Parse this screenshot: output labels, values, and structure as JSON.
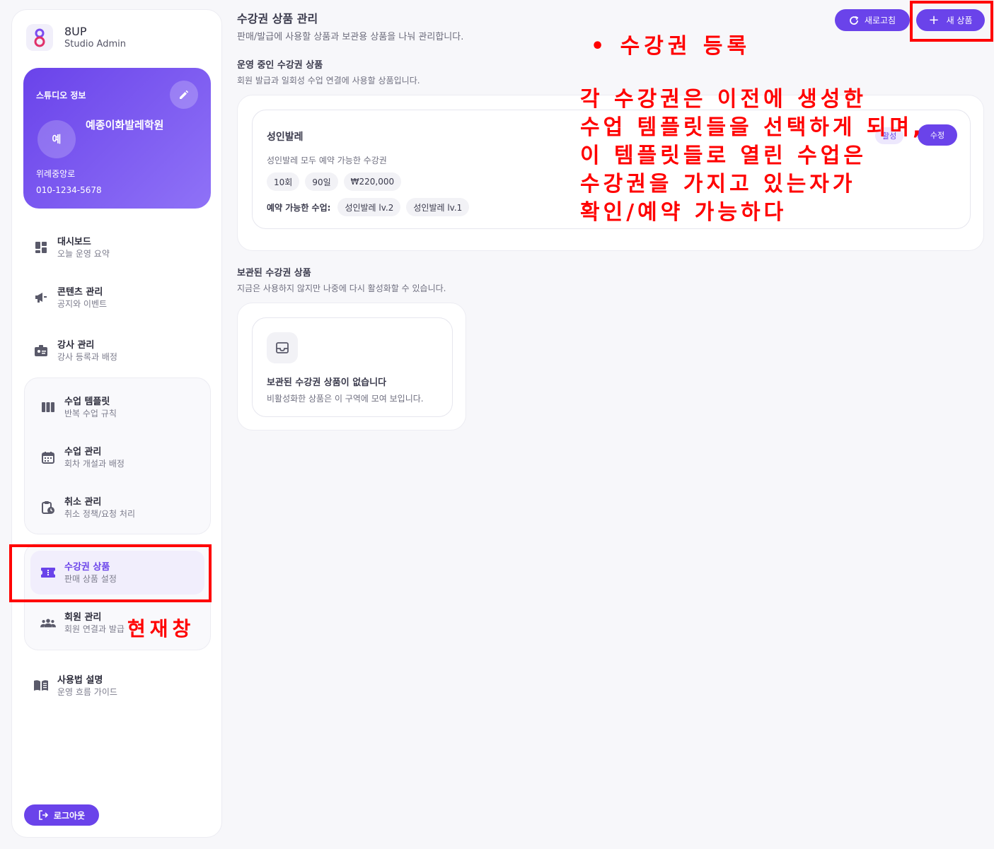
{
  "brand": {
    "name": "8UP",
    "subtitle": "Studio Admin"
  },
  "studio": {
    "label": "스튜디오 정보",
    "avatar": "예",
    "name": "예종이화발레학원",
    "address": "위례중앙로",
    "phone": "010-1234-5678"
  },
  "nav": {
    "dashboard": {
      "title": "대시보드",
      "sub": "오늘 운영 요약"
    },
    "content": {
      "title": "콘텐츠 관리",
      "sub": "공지와 이벤트"
    },
    "instructor": {
      "title": "강사 관리",
      "sub": "강사 등록과 배정"
    },
    "template": {
      "title": "수업 템플릿",
      "sub": "반복 수업 규칙"
    },
    "class": {
      "title": "수업 관리",
      "sub": "회차 개설과 배정"
    },
    "cancel": {
      "title": "취소 관리",
      "sub": "취소 정책/요청 처리"
    },
    "pass": {
      "title": "수강권 상품",
      "sub": "판매 상품 설정"
    },
    "member": {
      "title": "회원 관리",
      "sub": "회원 연결과 발급"
    },
    "guide": {
      "title": "사용법 설명",
      "sub": "운영 흐름 가이드"
    }
  },
  "logout_label": "로그아웃",
  "header": {
    "title": "수강권 상품 관리",
    "subtitle": "판매/발급에 사용할 상품과 보관용 상품을 나눠 관리합니다.",
    "refresh_label": "새로고침",
    "new_label": "새 상품"
  },
  "active_section": {
    "title": "운영 중인 수강권 상품",
    "subtitle": "회원 발급과 일회성 수업 연결에 사용할 상품입니다."
  },
  "product": {
    "name": "성인발레",
    "description": "성인발레 모두 예약 가능한 수강권",
    "count": "10회",
    "period": "90일",
    "price": "₩220,000",
    "status": "활성",
    "edit_label": "수정",
    "classes_label": "예약 가능한 수업:",
    "classes": [
      "성인발레 lv.2",
      "성인발레 lv.1"
    ]
  },
  "archived_section": {
    "title": "보관된 수강권 상품",
    "subtitle": "지금은 사용하지 않지만 나중에 다시 활성화할 수 있습니다.",
    "empty_title": "보관된 수강권 상품이 없습니다",
    "empty_sub": "비활성화한 상품은 이 구역에 모여 보입니다."
  },
  "annotations": {
    "register": "• 수강권 등록",
    "note_lines": [
      "각 수강권은 이전에 생성한",
      "수업 템플릿들을 선택하게 되며,",
      "이 템플릿들로 열린 수업은",
      "수강권을 가지고 있는자가",
      "확인/예약 가능하다"
    ],
    "current": "현재창"
  },
  "colors": {
    "accent": "#6a43ea",
    "annotation": "#ff0000"
  }
}
